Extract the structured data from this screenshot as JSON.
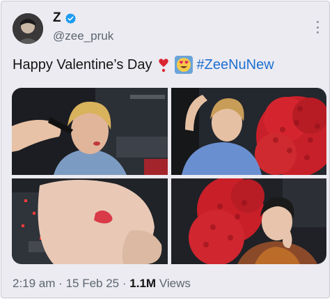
{
  "author": {
    "display_name": "Z",
    "handle": "@zee_pruk",
    "verified_icon": "verified-badge-icon",
    "verified_color": "#1d9bf0"
  },
  "tweet": {
    "text": "Happy Valentine’s Day",
    "emoji_1": "heart-exclamation-icon",
    "emoji_2": "heart-eyes-face-icon",
    "hashtag": "#ZeeNuNew",
    "hashtag_color": "#1d6fd1"
  },
  "media": {
    "photos": [
      "photo-1",
      "photo-2",
      "photo-3",
      "photo-4"
    ]
  },
  "meta": {
    "time": "2:19 am",
    "separator": "·",
    "date": "15 Feb 25",
    "views_count": "1.1M",
    "views_label": "Views"
  }
}
